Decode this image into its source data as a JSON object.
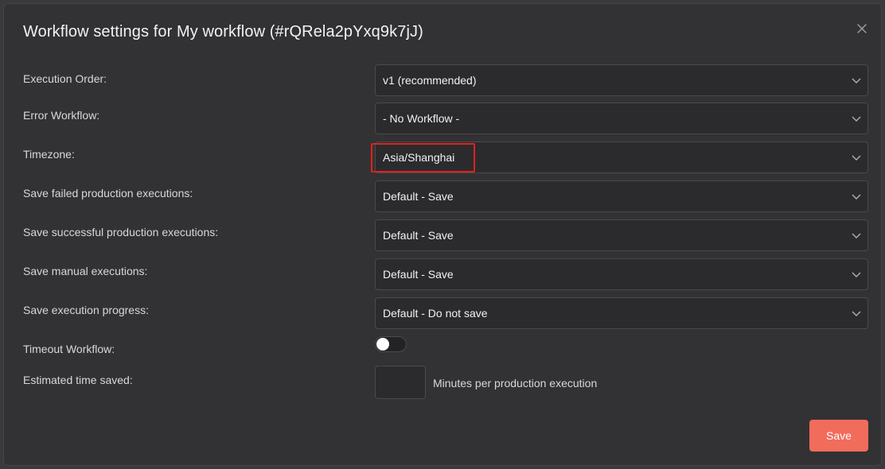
{
  "dialog": {
    "title": "Workflow settings for My workflow (#rQRela2pYxq9k7jJ)"
  },
  "settings": [
    {
      "label": "Execution Order:",
      "value": "v1 (recommended)"
    },
    {
      "label": "Error Workflow:",
      "value": "- No Workflow -"
    },
    {
      "label": "Timezone:",
      "value": "Asia/Shanghai"
    },
    {
      "label": "Save failed production executions:",
      "value": "Default - Save"
    },
    {
      "label": "Save successful production executions:",
      "value": "Default - Save"
    },
    {
      "label": "Save manual executions:",
      "value": "Default - Save"
    },
    {
      "label": "Save execution progress:",
      "value": "Default - Do not save"
    }
  ],
  "timeout": {
    "label": "Timeout Workflow:",
    "enabled": false
  },
  "time_saved": {
    "label": "Estimated time saved:",
    "value": "",
    "unit_label": "Minutes per production execution"
  },
  "footer": {
    "save_label": "Save"
  },
  "icons": {
    "close": "close-icon",
    "dropdown": "chevron-down-icon"
  },
  "colors": {
    "accent": "#f26c5c",
    "highlight": "#e0221f",
    "background": "#323234"
  }
}
